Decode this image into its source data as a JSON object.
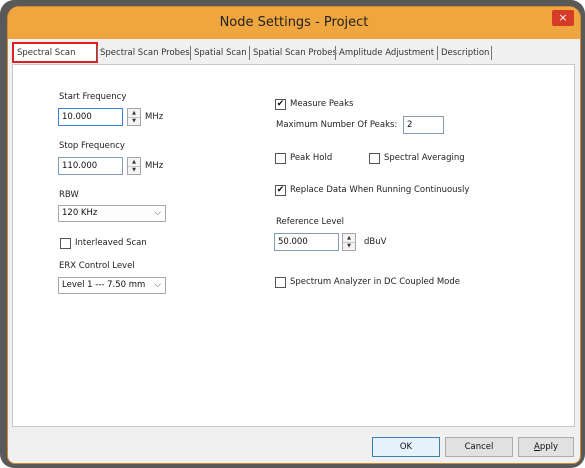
{
  "window": {
    "title": "Node Settings - Project",
    "close_glyph": "×"
  },
  "tabs": [
    {
      "label": "Spectral Scan",
      "active": true
    },
    {
      "label": "Spectral Scan Probes"
    },
    {
      "label": "Spatial Scan"
    },
    {
      "label": "Spatial Scan Probes"
    },
    {
      "label": "Amplitude Adjustment"
    },
    {
      "label": "Description"
    }
  ],
  "left": {
    "start_frequency": {
      "label": "Start Frequency",
      "value": "10.000",
      "unit": "MHz"
    },
    "stop_frequency": {
      "label": "Stop Frequency",
      "value": "110.000",
      "unit": "MHz"
    },
    "rbw": {
      "label": "RBW",
      "value": "120 KHz"
    },
    "interleaved_scan": {
      "label": "Interleaved Scan",
      "checked": false
    },
    "erx_control_level": {
      "label": "ERX Control Level",
      "value": "Level 1 --- 7.50 mm"
    }
  },
  "right": {
    "measure_peaks": {
      "label": "Measure Peaks",
      "checked": true
    },
    "max_peaks": {
      "label": "Maximum Number Of Peaks:",
      "value": "2"
    },
    "peak_hold": {
      "label": "Peak Hold",
      "checked": false
    },
    "spectral_averaging": {
      "label": "Spectral Averaging",
      "checked": false
    },
    "replace_data": {
      "label": "Replace Data When Running Continuously",
      "checked": true
    },
    "reference_level": {
      "label": "Reference Level",
      "value": "50.000",
      "unit": "dBuV"
    },
    "dc_coupled": {
      "label": "Spectrum Analyzer in DC Coupled Mode",
      "checked": false
    }
  },
  "buttons": {
    "ok": "OK",
    "cancel": "Cancel",
    "apply": "Apply"
  },
  "glyphs": {
    "check": "✔",
    "up": "▲",
    "down": "▼",
    "dropdown": "⌵"
  }
}
